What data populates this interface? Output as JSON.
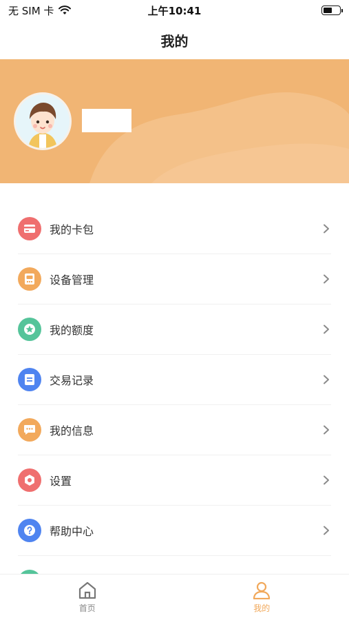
{
  "status_bar": {
    "carrier": "无 SIM 卡",
    "time": "上午10:41",
    "battery_level": 0.55
  },
  "nav": {
    "title": "我的"
  },
  "menu": {
    "items": [
      {
        "label": "我的卡包",
        "icon": "card-icon",
        "color": "#ef6f6f"
      },
      {
        "label": "设备管理",
        "icon": "device-icon",
        "color": "#f2a95c"
      },
      {
        "label": "我的额度",
        "icon": "star-icon",
        "color": "#55c49a"
      },
      {
        "label": "交易记录",
        "icon": "list-icon",
        "color": "#4f84f0"
      },
      {
        "label": "我的信息",
        "icon": "message-icon",
        "color": "#f2a95c"
      },
      {
        "label": "设置",
        "icon": "settings-icon",
        "color": "#ef6f6f"
      },
      {
        "label": "帮助中心",
        "icon": "help-icon",
        "color": "#4f84f0"
      }
    ]
  },
  "tabs": [
    {
      "label": "首页",
      "icon": "home-icon",
      "color": "#888888"
    },
    {
      "label": "我的",
      "icon": "user-icon",
      "color": "#f1a85a"
    }
  ],
  "colors": {
    "accent": "#f1b574",
    "tab_active": "#f1a85a"
  }
}
